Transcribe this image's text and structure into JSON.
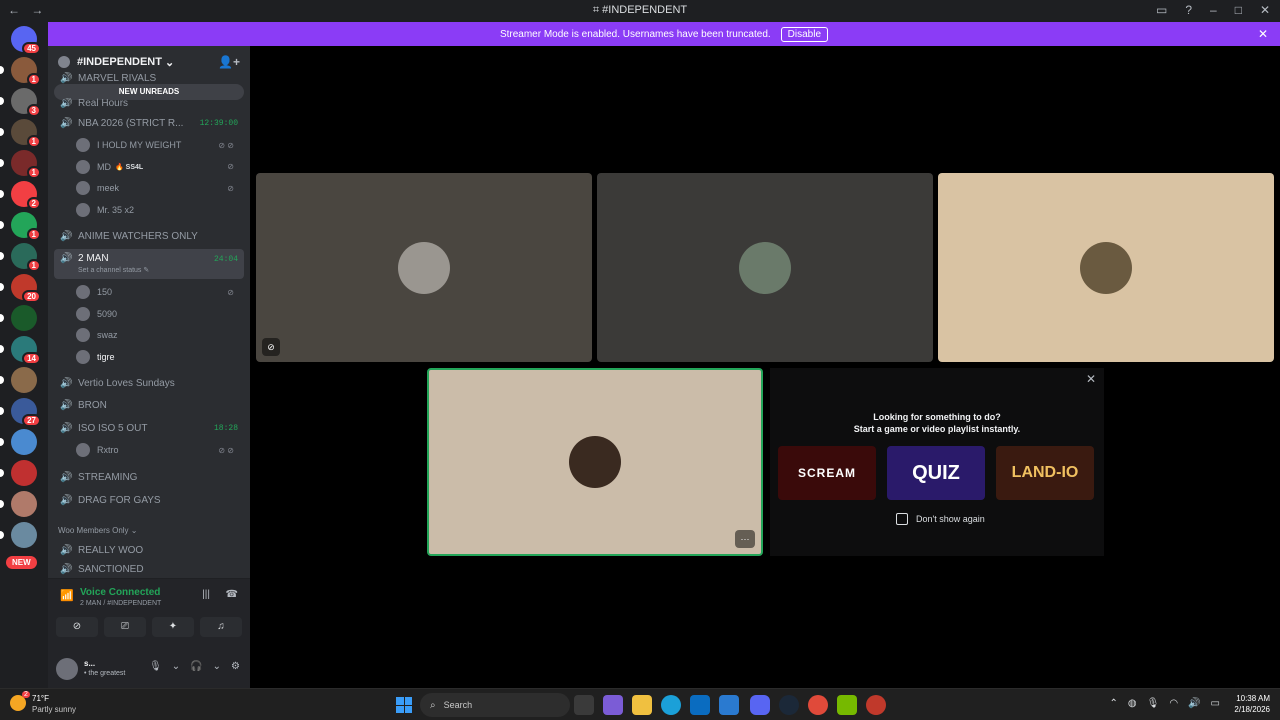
{
  "window": {
    "title": "#INDEPENDENT",
    "back_glyph": "←",
    "forward_glyph": "→"
  },
  "banner": {
    "text": "Streamer Mode is enabled. Usernames have been truncated.",
    "disable_label": "Disable"
  },
  "servers": {
    "new_label": "NEW",
    "items": [
      {
        "name": "home",
        "badge": "45",
        "color": "#5865f2"
      },
      {
        "name": "server-1",
        "badge": "1",
        "color": "#8a5a3c"
      },
      {
        "name": "server-2",
        "badge": "3",
        "color": "#6a6a6a"
      },
      {
        "name": "server-3",
        "badge": "1",
        "color": "#5a4a3a"
      },
      {
        "name": "server-4",
        "badge": "1",
        "color": "#7a2a2a"
      },
      {
        "name": "server-5",
        "badge": "2",
        "color": "#f23f43"
      },
      {
        "name": "server-6",
        "badge": "1",
        "color": "#23a559"
      },
      {
        "name": "server-7",
        "badge": "1",
        "color": "#2a6a5a"
      },
      {
        "name": "server-8",
        "badge": "20",
        "color": "#c0392b"
      },
      {
        "name": "server-9",
        "badge": "",
        "color": "#1a5a2a"
      },
      {
        "name": "server-10",
        "badge": "14",
        "color": "#2a7a7a"
      },
      {
        "name": "server-11",
        "badge": "",
        "color": "#8a6a4a"
      },
      {
        "name": "server-12",
        "badge": "27",
        "color": "#3a5a9a"
      },
      {
        "name": "server-13",
        "badge": "",
        "color": "#4a8ad0"
      },
      {
        "name": "server-14",
        "badge": "",
        "color": "#c03030"
      },
      {
        "name": "server-15",
        "badge": "",
        "color": "#b07a6a"
      },
      {
        "name": "server-16",
        "badge": "",
        "color": "#6a8aa0"
      }
    ]
  },
  "guild": {
    "name": "#INDEPENDENT",
    "new_unreads": "NEW UNREADS"
  },
  "channels": {
    "partial_top_1": "MARVEL RIVALS",
    "partial_top_2": "Real  Hours",
    "nba": {
      "name": "NBA 2026 (STRICT R...",
      "time": "12:39:00"
    },
    "nba_users": [
      {
        "name": "I HOLD MY WEIGHT",
        "tag": "",
        "mute": "⊘ ⊘"
      },
      {
        "name": "MD",
        "tag": "🔥 SS4L",
        "mute": "⊘"
      },
      {
        "name": "meek",
        "tag": "",
        "mute": "⊘"
      },
      {
        "name": "Mr. 35 x2",
        "tag": "",
        "mute": ""
      }
    ],
    "anime": "ANIME WATCHERS ONLY",
    "two_man": {
      "name": "2 MAN",
      "time": "24:04",
      "status": "Set a channel status ✎"
    },
    "two_man_users": [
      {
        "name": "150",
        "mute": "⊘"
      },
      {
        "name": "5090",
        "mute": ""
      },
      {
        "name": "swaz",
        "mute": ""
      },
      {
        "name": "tigre",
        "mute": ""
      }
    ],
    "vertio": "Vertio Loves Sundays",
    "bron": "BRON",
    "iso": {
      "name": "ISO ISO 5 OUT",
      "time": "18:28"
    },
    "iso_users": [
      {
        "name": "Rxtro",
        "mute": "⊘ ⊘"
      }
    ],
    "streaming": "STREAMING",
    "drag": "DRAG FOR GAYS",
    "category": "Woo Members Only ⌄",
    "really_woo": "REALLY WOO",
    "sanctioned": "SANCTIONED"
  },
  "voice": {
    "status": "Voice Connected",
    "location": "2 MAN / #INDEPENDENT"
  },
  "user": {
    "name": "s...",
    "status": "• the greatest"
  },
  "activity": {
    "heading_1": "Looking for something to do?",
    "heading_2": "Start a game or video playlist instantly.",
    "games": [
      {
        "name": "SCREAM",
        "bg": "#3a0a0a"
      },
      {
        "name": "QUIZ",
        "bg": "#2a1a6a"
      },
      {
        "name": "LAND-IO",
        "bg": "#3a1a10"
      }
    ],
    "dont_show": "Don't show again"
  },
  "tiles": {
    "colors": [
      "#4a4640",
      "#3b3a38",
      "#d9c3a3",
      "#cbbca9"
    ],
    "accent": "#23a559"
  },
  "taskbar": {
    "weather_badge": "2",
    "temperature": "71°F",
    "condition": "Partly sunny",
    "search_placeholder": "Search",
    "time": "10:38 AM",
    "date": "2/18/2026"
  }
}
